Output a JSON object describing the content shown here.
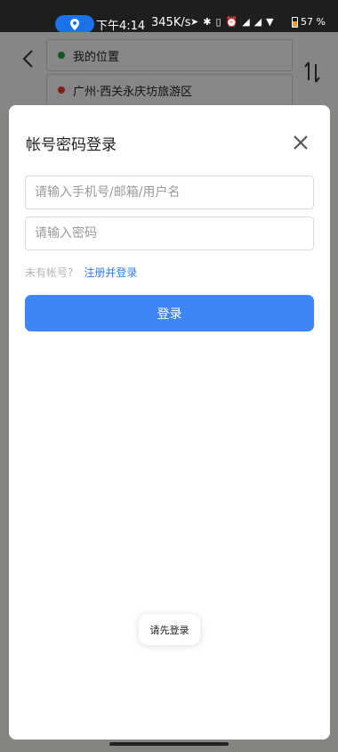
{
  "status_bar": {
    "time": "下午4:14",
    "net_speed": "345K/s",
    "battery": "57 %",
    "battery_level": 0.57,
    "icons": [
      "location-pill-icon",
      "send-icon",
      "bluetooth-icon",
      "vibrate-icon",
      "alarm-icon",
      "signal-4g-icon",
      "signal-icon",
      "wifi-icon",
      "battery-icon"
    ]
  },
  "route": {
    "origin": "我的位置",
    "destination": "广州·西关永庆坊旅游区",
    "origin_color": "#1e9e3c",
    "destination_color": "#e03a2f"
  },
  "login_dialog": {
    "title": "帐号密码登录",
    "username_placeholder": "请输入手机号/邮箱/用户名",
    "password_placeholder": "请输入密码",
    "no_account_text": "未有帐号?",
    "register_link": "注册并登录",
    "login_button": "登录",
    "accent_color": "#3e86f8"
  },
  "toast": {
    "message": "请先登录"
  }
}
